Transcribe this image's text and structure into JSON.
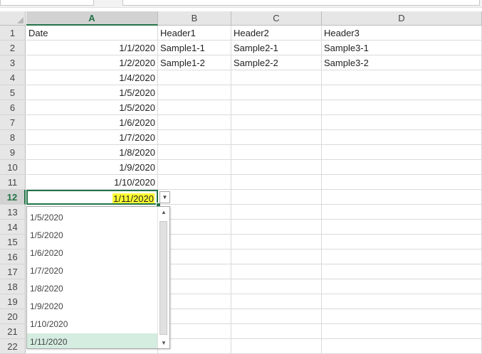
{
  "columns": [
    "A",
    "B",
    "C",
    "D"
  ],
  "rows": [
    {
      "num": "1",
      "a": "Date",
      "b": "Header1",
      "c": "Header2",
      "d": "Header3"
    },
    {
      "num": "2",
      "a": "1/1/2020",
      "b": "Sample1-1",
      "c": "Sample2-1",
      "d": "Sample3-1"
    },
    {
      "num": "3",
      "a": "1/2/2020",
      "b": "Sample1-2",
      "c": "Sample2-2",
      "d": "Sample3-2"
    },
    {
      "num": "4",
      "a": "1/4/2020"
    },
    {
      "num": "5",
      "a": "1/5/2020"
    },
    {
      "num": "6",
      "a": "1/5/2020"
    },
    {
      "num": "7",
      "a": "1/6/2020"
    },
    {
      "num": "8",
      "a": "1/7/2020"
    },
    {
      "num": "9",
      "a": "1/8/2020"
    },
    {
      "num": "10",
      "a": "1/9/2020"
    },
    {
      "num": "11",
      "a": "1/10/2020"
    },
    {
      "num": "12",
      "a": "1/11/2020"
    },
    {
      "num": "13"
    },
    {
      "num": "14"
    },
    {
      "num": "15"
    },
    {
      "num": "16"
    },
    {
      "num": "17"
    },
    {
      "num": "18"
    },
    {
      "num": "19"
    },
    {
      "num": "20"
    },
    {
      "num": "21"
    },
    {
      "num": "22"
    }
  ],
  "active_cell": {
    "row": "12",
    "column": "A"
  },
  "dropdown": {
    "items": [
      "1/5/2020",
      "1/5/2020",
      "1/6/2020",
      "1/7/2020",
      "1/8/2020",
      "1/9/2020",
      "1/10/2020",
      "1/11/2020"
    ],
    "selected": "1/11/2020",
    "scroll_up": "▲",
    "scroll_down": "▼"
  },
  "dropdown_button": "▼",
  "colors": {
    "accent": "#217346",
    "highlight": "#ffff33",
    "selection": "#d5ece0"
  }
}
